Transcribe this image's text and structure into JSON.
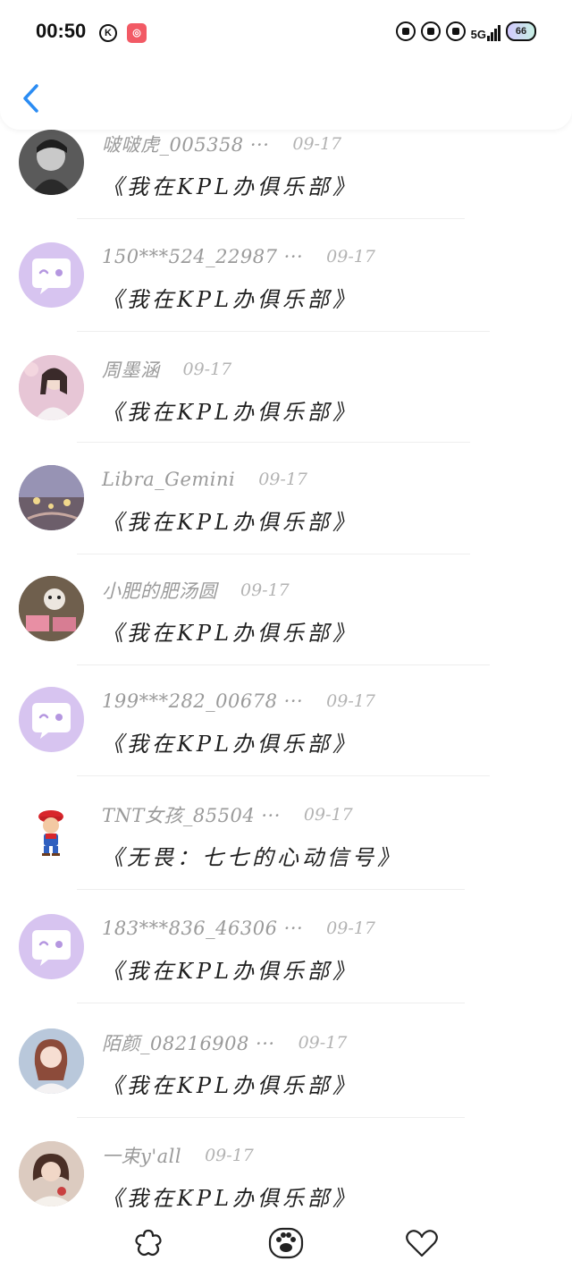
{
  "status_bar": {
    "time": "00:50",
    "app_icon_k": "K",
    "network": "5G",
    "battery": "66"
  },
  "nav": {
    "back_icon": "chevron-left-icon"
  },
  "comments": [
    {
      "username": "啵啵虎_005358 ···",
      "date": "09-17",
      "text": "《我在KPL办俱乐部》",
      "avatar": "photo"
    },
    {
      "username": "150***524_22987 ···",
      "date": "09-17",
      "text": "《我在KPL办俱乐部》",
      "avatar": "default"
    },
    {
      "username": "周墨涵",
      "date": "09-17",
      "text": "《我在KPL办俱乐部》",
      "avatar": "photo"
    },
    {
      "username": "Libra_Gemini",
      "date": "09-17",
      "text": "《我在KPL办俱乐部》",
      "avatar": "photo"
    },
    {
      "username": "小肥的肥汤圆",
      "date": "09-17",
      "text": "《我在KPL办俱乐部》",
      "avatar": "photo"
    },
    {
      "username": "199***282_00678 ···",
      "date": "09-17",
      "text": "《我在KPL办俱乐部》",
      "avatar": "default"
    },
    {
      "username": "TNT女孩_85504 ···",
      "date": "09-17",
      "text": "《无畏：七七的心动信号》",
      "avatar": "cartoon"
    },
    {
      "username": "183***836_46306 ···",
      "date": "09-17",
      "text": "《我在KPL办俱乐部》",
      "avatar": "default"
    },
    {
      "username": "陌颜_08216908 ···",
      "date": "09-17",
      "text": "《我在KPL办俱乐部》",
      "avatar": "photo"
    },
    {
      "username": "一束y'all",
      "date": "09-17",
      "text": "《我在KPL办俱乐部》",
      "avatar": "photo"
    }
  ],
  "bottom_bar": {
    "tabs": [
      "flower-icon",
      "paw-icon",
      "heart-icon"
    ]
  },
  "colors": {
    "accent_blue": "#2b8cf3",
    "default_avatar": "#d7c4f0",
    "username_gray": "#9a9a9a"
  }
}
